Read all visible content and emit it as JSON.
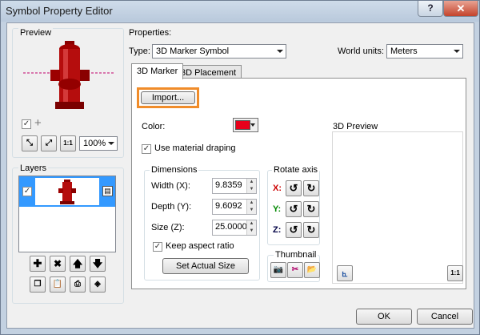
{
  "window": {
    "title": "Symbol Property Editor",
    "help": "?",
    "close": "✕"
  },
  "preview": {
    "label": "Preview",
    "zoom": "100%"
  },
  "layers": {
    "label": "Layers"
  },
  "properties": {
    "label": "Properties:",
    "type_label": "Type:",
    "type_value": "3D Marker Symbol",
    "world_units_label": "World units:",
    "world_units_value": "Meters"
  },
  "tabs": [
    "3D Marker",
    "3D Placement"
  ],
  "marker": {
    "import_label": "Import...",
    "color_label": "Color:",
    "color_value": "#e8001a",
    "use_material_draping": "Use material draping",
    "dimensions_label": "Dimensions",
    "width_label": "Width (X):",
    "width_value": "9.8359",
    "depth_label": "Depth (Y):",
    "depth_value": "9.6092",
    "size_label": "Size (Z):",
    "size_value": "25.0000",
    "keep_aspect": "Keep aspect ratio",
    "set_actual_size": "Set Actual Size",
    "rotate_label": "Rotate axis",
    "axis_x": "X:",
    "axis_y": "Y:",
    "axis_z": "Z:",
    "thumbnail_label": "Thumbnail",
    "preview3d_label": "3D Preview"
  },
  "buttons": {
    "ok": "OK",
    "cancel": "Cancel"
  }
}
